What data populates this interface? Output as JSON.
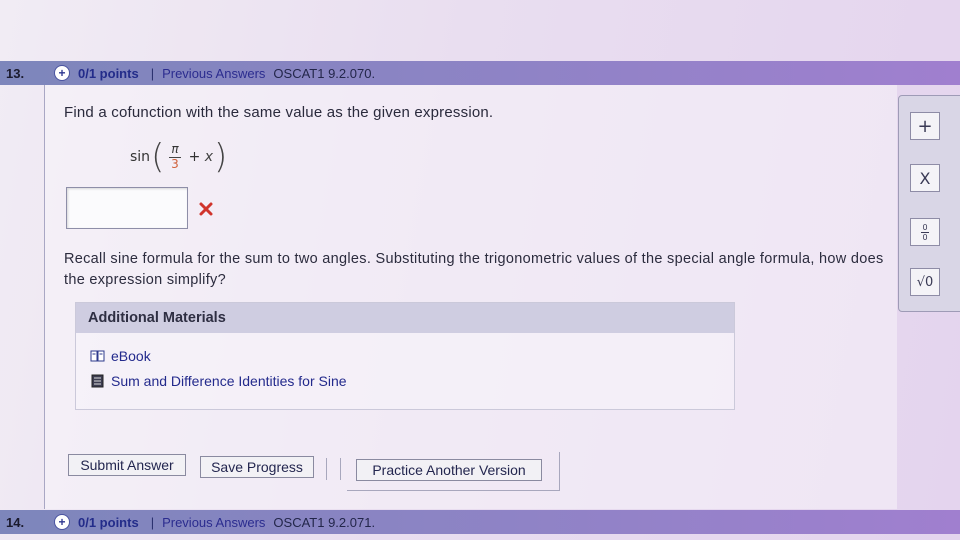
{
  "question_13": {
    "number": "13.",
    "points": "0/1 points",
    "separator": "|",
    "previous_answers": "Previous Answers",
    "code": "OSCAT1 9.2.070."
  },
  "prompt": "Find a cofunction with the same value as the given expression.",
  "expression": {
    "func": "sin",
    "numerator": "π",
    "denominator": "3",
    "tail_op": "+ ",
    "tail_var": "x"
  },
  "answer": {
    "value": "",
    "status": "incorrect"
  },
  "hint": "Recall sine formula for the sum to two angles. Substituting the trigonometric values of the special angle formula, how does the expression simplify?",
  "materials": {
    "title": "Additional Materials",
    "items": [
      {
        "label": "eBook",
        "icon": "book-icon"
      },
      {
        "label": "Sum and Difference Identities for Sine",
        "icon": "document-icon"
      }
    ]
  },
  "buttons": {
    "submit": "Submit Answer",
    "save": "Save Progress",
    "practice": "Practice Another Version"
  },
  "toolbar": {
    "plus": "+",
    "times": "X",
    "fraction_top": "0",
    "fraction_bottom": "0",
    "sqrt": "√0"
  },
  "question_14": {
    "number": "14.",
    "points": "0/1 points",
    "separator": "|",
    "previous_answers": "Previous Answers",
    "code": "OSCAT1 9.2.071."
  },
  "colors": {
    "header_bar": "#8a86c2",
    "link": "#2b2c8f",
    "incorrect": "#d0342c"
  }
}
